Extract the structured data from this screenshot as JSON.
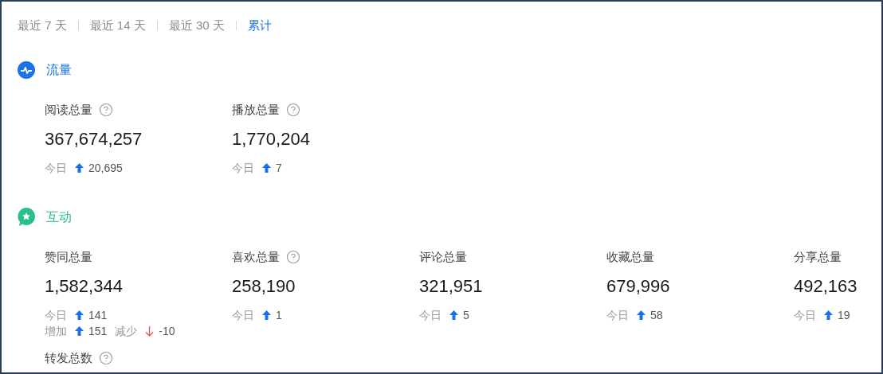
{
  "period_tabs": [
    {
      "label": "最近 7 天",
      "selected": false
    },
    {
      "label": "最近 14 天",
      "selected": false
    },
    {
      "label": "最近 30 天",
      "selected": false
    },
    {
      "label": "累计",
      "selected": true
    }
  ],
  "sections": [
    {
      "title": "流量",
      "kind": "traffic",
      "color": "#1a73e8",
      "metrics": [
        {
          "label": "阅读总量",
          "help": true,
          "value": "367,674,257",
          "changes": [
            [
              {
                "label": "今日",
                "kind": "up",
                "amount": "20,695"
              }
            ]
          ]
        },
        {
          "label": "播放总量",
          "help": true,
          "value": "1,770,204",
          "changes": [
            [
              {
                "label": "今日",
                "kind": "up",
                "amount": "7"
              }
            ]
          ]
        }
      ]
    },
    {
      "title": "互动",
      "kind": "interaction",
      "color": "#2bbf8f",
      "metrics": [
        {
          "label": "赞同总量",
          "help": false,
          "value": "1,582,344",
          "changes": [
            [
              {
                "label": "今日",
                "kind": "up",
                "amount": "141"
              }
            ],
            [
              {
                "label": "增加",
                "kind": "up",
                "amount": "151"
              },
              {
                "label": "减少",
                "kind": "down",
                "amount": "-10"
              }
            ]
          ]
        },
        {
          "label": "喜欢总量",
          "help": true,
          "value": "258,190",
          "changes": [
            [
              {
                "label": "今日",
                "kind": "up",
                "amount": "1"
              }
            ]
          ]
        },
        {
          "label": "评论总量",
          "help": false,
          "value": "321,951",
          "changes": [
            [
              {
                "label": "今日",
                "kind": "up",
                "amount": "5"
              }
            ]
          ]
        },
        {
          "label": "收藏总量",
          "help": false,
          "value": "679,996",
          "changes": [
            [
              {
                "label": "今日",
                "kind": "up",
                "amount": "58"
              }
            ]
          ]
        },
        {
          "label": "分享总量",
          "help": false,
          "value": "492,163",
          "changes": [
            [
              {
                "label": "今日",
                "kind": "up",
                "amount": "19"
              }
            ]
          ]
        },
        {
          "label": "转发总数",
          "help": true
        }
      ]
    }
  ]
}
